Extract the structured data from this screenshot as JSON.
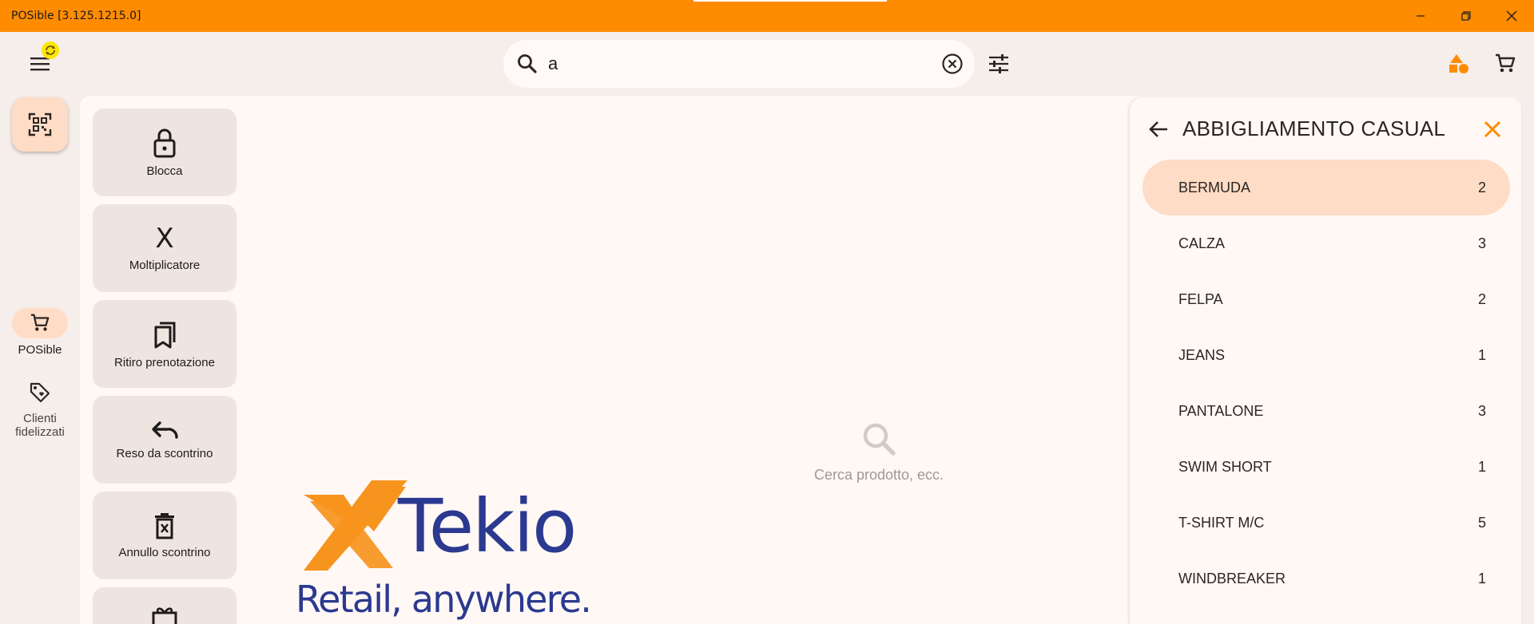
{
  "window": {
    "title": "POSible [3.125.1215.0]"
  },
  "search": {
    "value": "a"
  },
  "rail": {
    "items": [
      {
        "label": "POSible"
      },
      {
        "label": "Clienti fidelizzati"
      }
    ]
  },
  "actions": [
    {
      "label": "Blocca",
      "icon": "lock-icon"
    },
    {
      "label": "Moltiplicatore",
      "glyph": "X"
    },
    {
      "label": "Ritiro prenotazione",
      "icon": "bookmarks-icon"
    },
    {
      "label": "Reso da scontrino",
      "icon": "undo-icon"
    },
    {
      "label": "Annullo scontrino",
      "icon": "delete-receipt-icon"
    }
  ],
  "empty_state": {
    "text": "Cerca prodotto, ecc."
  },
  "logo": {
    "brand": "Tekio",
    "tagline": "Retail, anywhere."
  },
  "category_panel": {
    "title": "ABBIGLIAMENTO CASUAL",
    "items": [
      {
        "name": "BERMUDA",
        "count": "2",
        "selected": true
      },
      {
        "name": "CALZA",
        "count": "3"
      },
      {
        "name": "FELPA",
        "count": "2"
      },
      {
        "name": "JEANS",
        "count": "1"
      },
      {
        "name": "PANTALONE",
        "count": "3"
      },
      {
        "name": "SWIM SHORT",
        "count": "1"
      },
      {
        "name": "T-SHIRT M/C",
        "count": "5"
      },
      {
        "name": "WINDBREAKER",
        "count": "1"
      }
    ]
  },
  "colors": {
    "titlebar": "#ff8c00",
    "accent": "#ff8c00",
    "selected": "#ffdcc5",
    "logo_orange": "#f7941d",
    "logo_blue": "#2b3990"
  }
}
